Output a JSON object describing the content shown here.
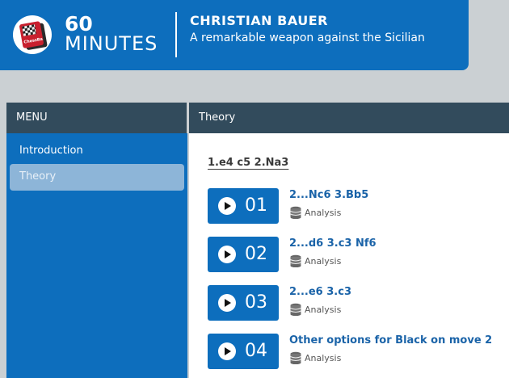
{
  "header": {
    "brand_number": "60",
    "brand_word": "MINUTES",
    "logo_text": "ChessBase",
    "author": "CHRISTIAN BAUER",
    "subtitle": "A remarkable weapon against the Sicilian"
  },
  "menu": {
    "title": "MENU",
    "items": [
      {
        "label": "Introduction",
        "active": false
      },
      {
        "label": "Theory",
        "active": true
      }
    ]
  },
  "content": {
    "title": "Theory",
    "section_title": "1.e4 c5 2.Na3",
    "lessons": [
      {
        "number": "01",
        "title": "2...Nc6 3.Bb5",
        "tag": "Analysis"
      },
      {
        "number": "02",
        "title": "2...d6 3.c3 Nf6",
        "tag": "Analysis"
      },
      {
        "number": "03",
        "title": "2...e6 3.c3",
        "tag": "Analysis"
      },
      {
        "number": "04",
        "title": "Other options for Black on move 2",
        "tag": "Analysis"
      }
    ]
  },
  "colors": {
    "brand_blue": "#0d6ebd",
    "header_bar": "#324b5c",
    "active_item": "#8db5d8",
    "link": "#1a63a8"
  },
  "icons": {
    "play": "play-icon",
    "database": "database-icon",
    "logo": "chessbase-logo-icon"
  }
}
